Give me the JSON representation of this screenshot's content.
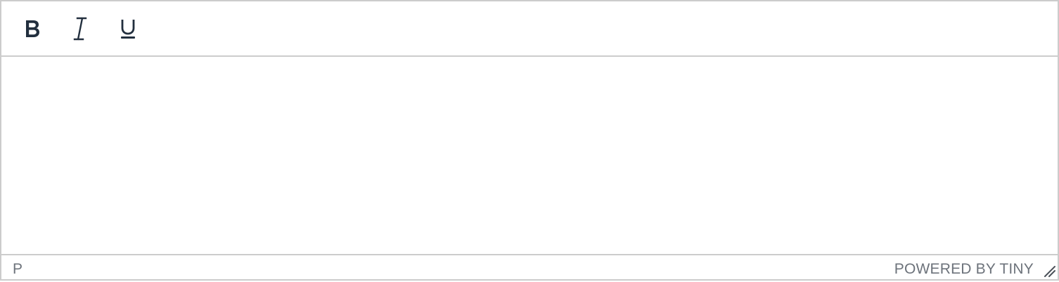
{
  "toolbar": {
    "buttons": [
      {
        "name": "bold",
        "icon": "bold-icon"
      },
      {
        "name": "italic",
        "icon": "italic-icon"
      },
      {
        "name": "underline",
        "icon": "underline-icon"
      }
    ]
  },
  "editor": {
    "content": ""
  },
  "statusbar": {
    "path": "P",
    "branding": "POWERED BY TINY",
    "resize_icon": "resize-handle-icon"
  },
  "colors": {
    "border": "#cccccc",
    "icon": "#222f3e",
    "status_text": "#6d737b",
    "background": "#ffffff"
  }
}
